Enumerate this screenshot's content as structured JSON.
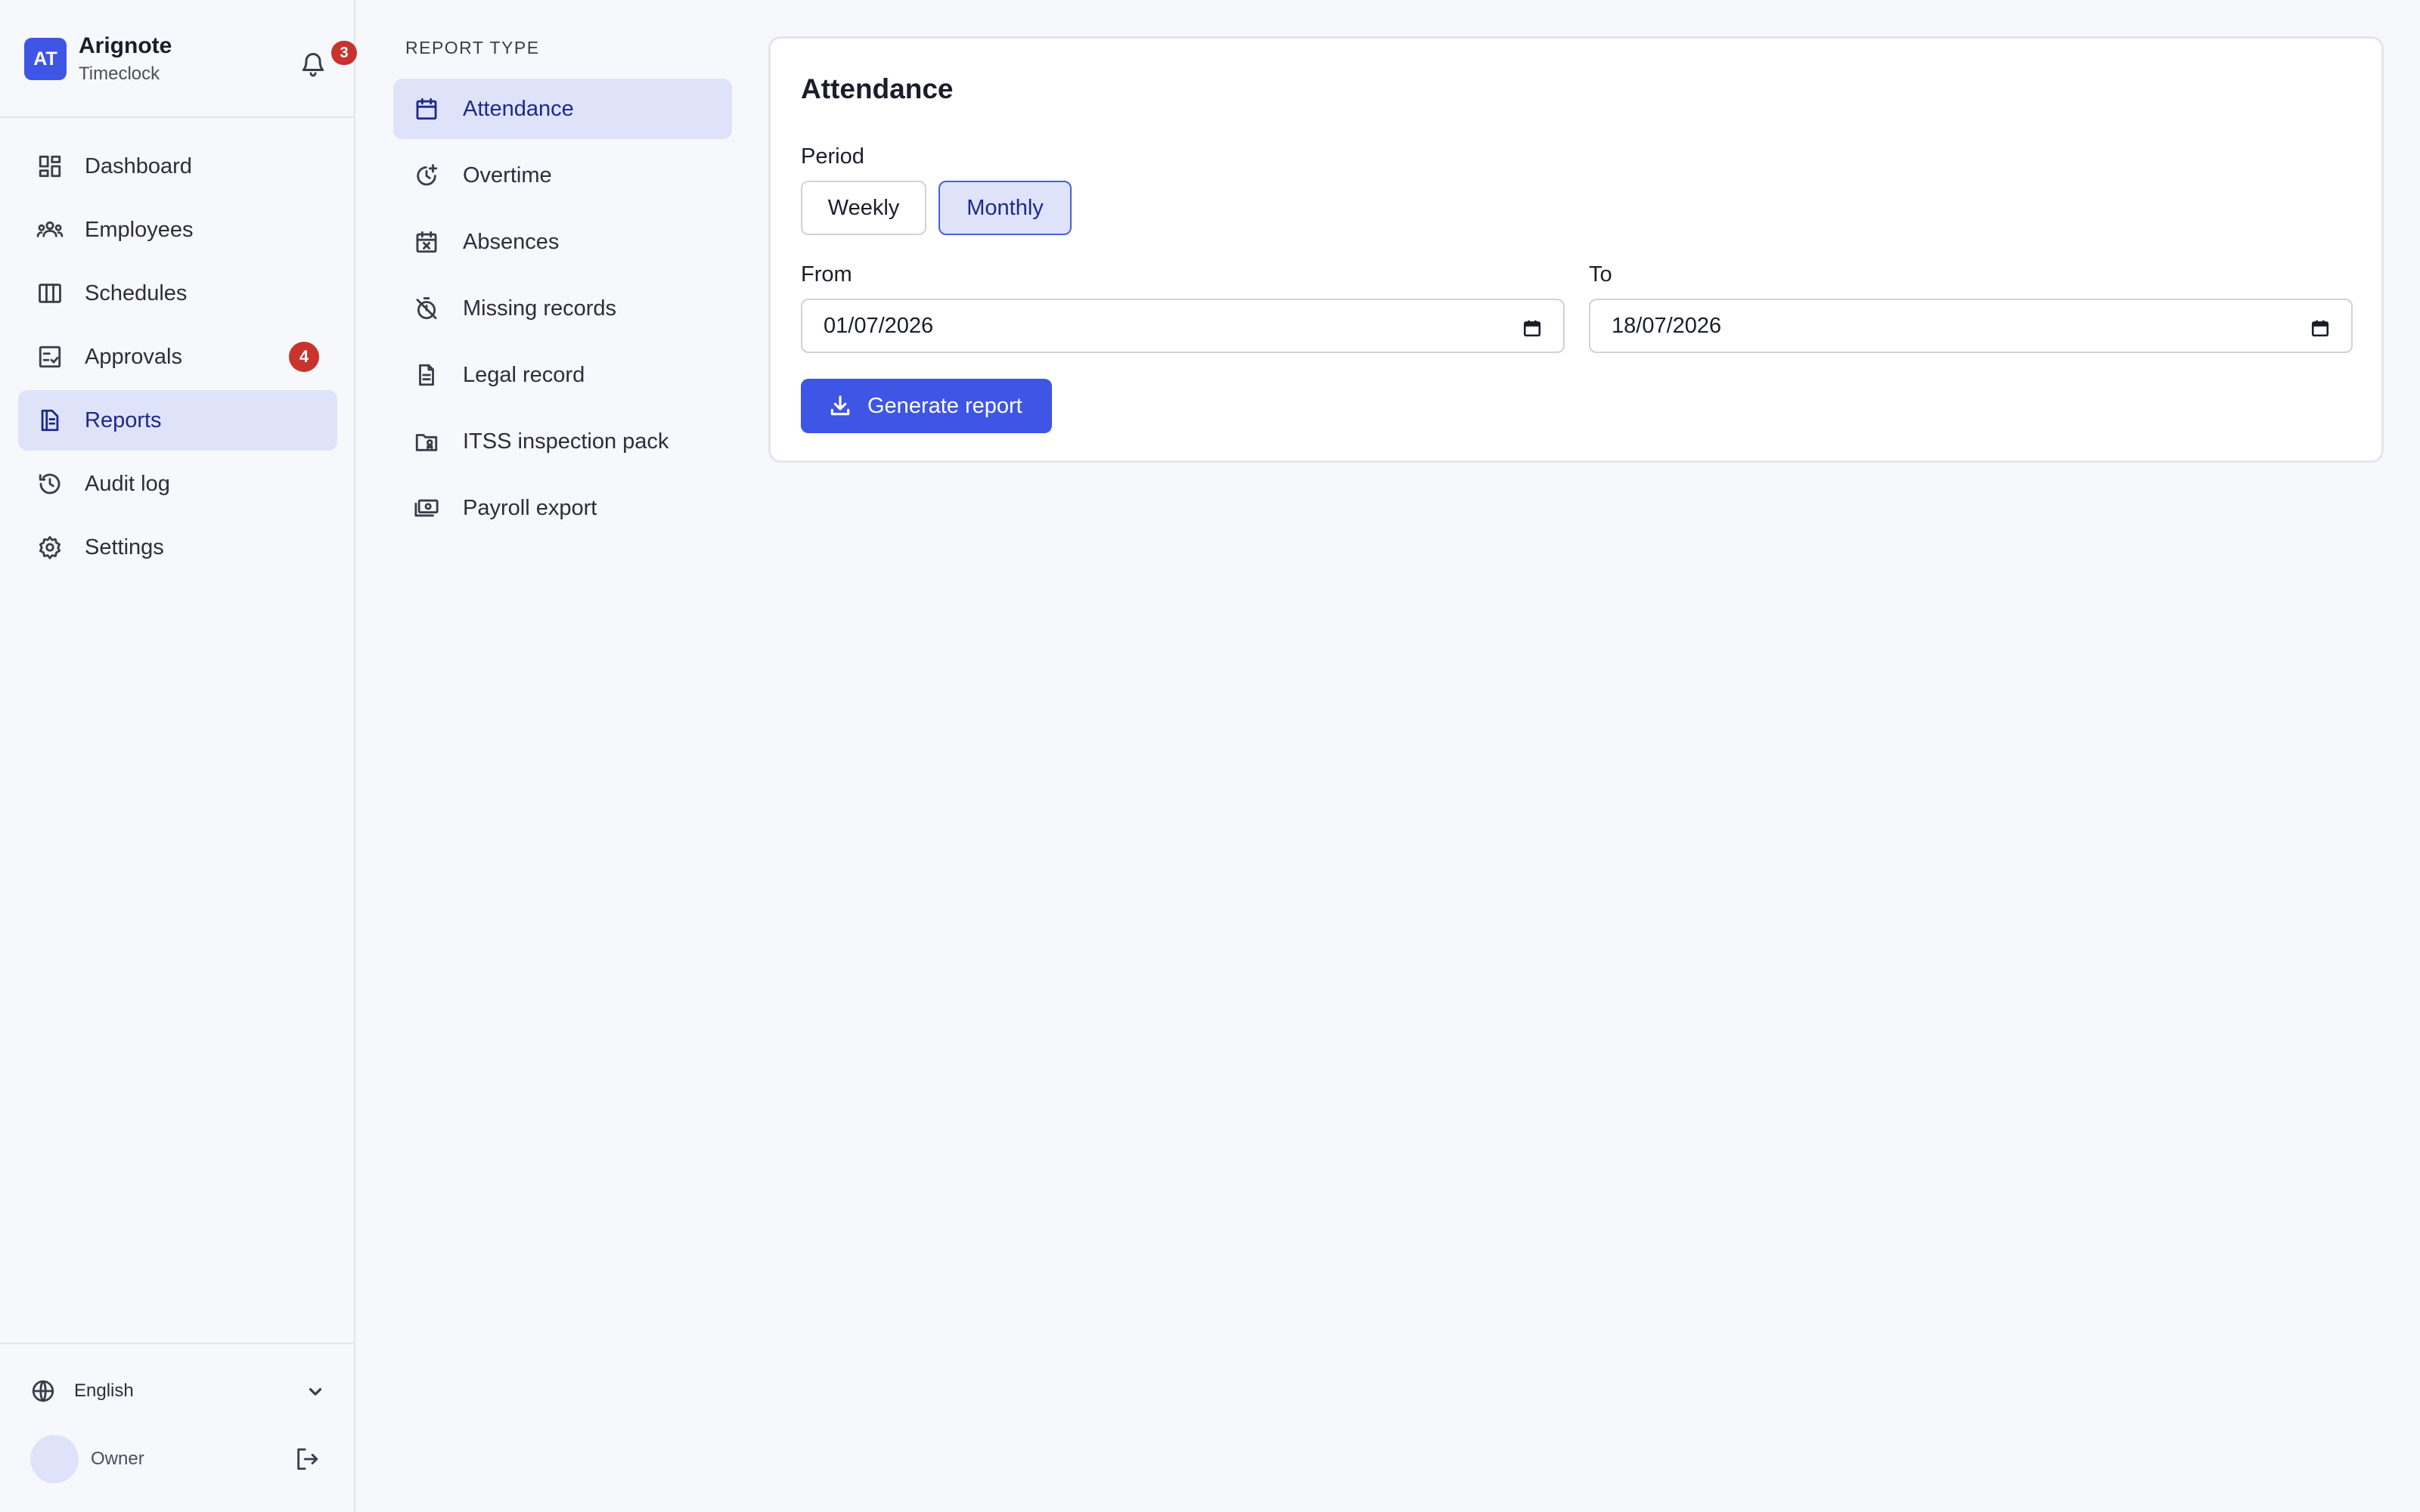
{
  "brand": {
    "initials": "AT",
    "name": "Arignote",
    "subtitle": "Timeclock",
    "notification_count": "3"
  },
  "nav": {
    "items": [
      {
        "label": "Dashboard",
        "icon": "dashboard-icon"
      },
      {
        "label": "Employees",
        "icon": "people-icon"
      },
      {
        "label": "Schedules",
        "icon": "columns-icon"
      },
      {
        "label": "Approvals",
        "icon": "checklist-icon",
        "badge": "4"
      },
      {
        "label": "Reports",
        "icon": "report-icon",
        "active": true
      },
      {
        "label": "Audit log",
        "icon": "history-icon"
      },
      {
        "label": "Settings",
        "icon": "gear-icon"
      }
    ]
  },
  "footer": {
    "language": "English",
    "user_name": "Owner"
  },
  "report_types": {
    "title": "REPORT TYPE",
    "items": [
      {
        "label": "Attendance",
        "icon": "calendar-icon",
        "active": true
      },
      {
        "label": "Overtime",
        "icon": "clock-plus-icon"
      },
      {
        "label": "Absences",
        "icon": "calendar-x-icon"
      },
      {
        "label": "Missing records",
        "icon": "timer-off-icon"
      },
      {
        "label": "Legal record",
        "icon": "document-icon"
      },
      {
        "label": "ITSS inspection pack",
        "icon": "folder-badge-icon"
      },
      {
        "label": "Payroll export",
        "icon": "money-icon"
      }
    ]
  },
  "card": {
    "title": "Attendance",
    "period_label": "Period",
    "period_options": [
      "Weekly",
      "Monthly"
    ],
    "period_selected": "Monthly",
    "from_label": "From",
    "from_value": "01/07/2026",
    "to_label": "To",
    "to_value": "18/07/2026",
    "generate_label": "Generate report"
  },
  "colors": {
    "accent": "#3e55e5",
    "active_bg": "#dfe3fa",
    "badge": "#c8332d"
  }
}
